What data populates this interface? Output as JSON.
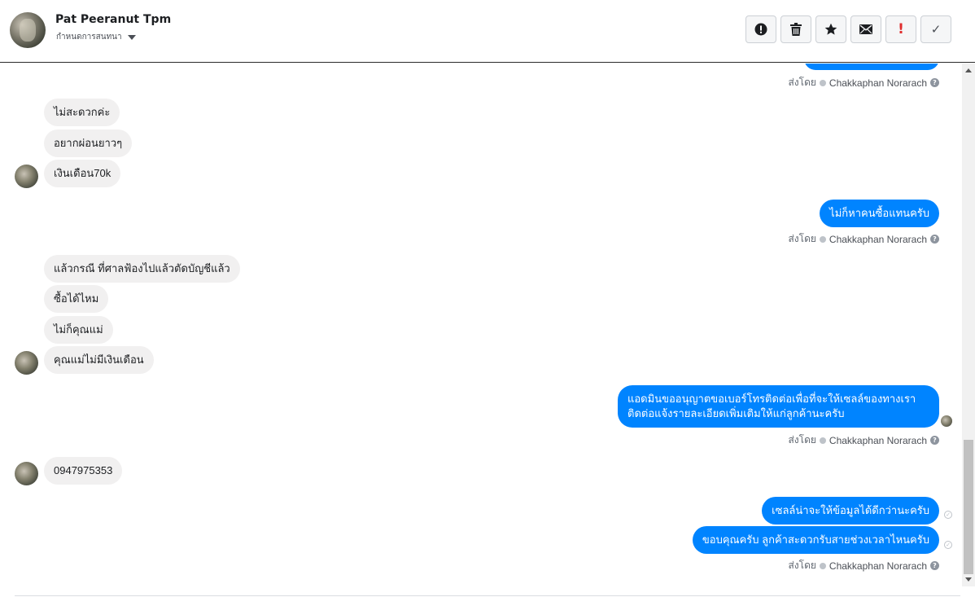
{
  "header": {
    "contact_name": "Pat Peeranut Tpm",
    "stage_label": "กำหนดการสนทนา",
    "actions": [
      {
        "name": "spam-report",
        "icon": "exclamation-circle-icon"
      },
      {
        "name": "delete",
        "icon": "trash-icon"
      },
      {
        "name": "star",
        "icon": "star-icon"
      },
      {
        "name": "mark-unread",
        "icon": "envelope-icon"
      },
      {
        "name": "follow-up",
        "icon": "exclamation-icon",
        "glyph": "!"
      },
      {
        "name": "mark-done",
        "icon": "check-icon",
        "glyph": "✓"
      }
    ]
  },
  "sent_by": {
    "prefix": "ส่งโดย",
    "agent": "Chakkaphan Norarach",
    "help": "?"
  },
  "messages": {
    "in_1": "ไม่สะดวกค่ะ",
    "in_2": "อยากผ่อนยาวๆ",
    "in_3": "เงินเดือน70k",
    "out_1": "ไม่ก็หาคนซื้อแทนครับ",
    "in_4": "แล้วกรณี  ที่ศาลฟ้องไปแล้วตัดบัญชีแล้ว",
    "in_5": "ซื้อได้ไหม",
    "in_6": "ไม่ก็คุณแม่",
    "in_7": "คุณแม่ไม่มีเงินเดือน",
    "out_2": "แอดมินขออนุญาตขอเบอร์โทรติดต่อเพื่อที่จะให้เซลล์ของทางเราติดต่อแจ้งรายละเอียดเพิ่มเติมให้แก่ลูกค้านะครับ",
    "in_8": "0947975353",
    "out_3": "เซลล์น่าจะให้ข้อมูลได้ดีกว่านะครับ",
    "out_4": "ขอบคุณครับ ลูกค้าสะดวกรับสายช่วงเวลาไหนครับ"
  },
  "colors": {
    "outgoing_bubble": "#0084ff",
    "incoming_bubble": "#f1f0f0"
  }
}
